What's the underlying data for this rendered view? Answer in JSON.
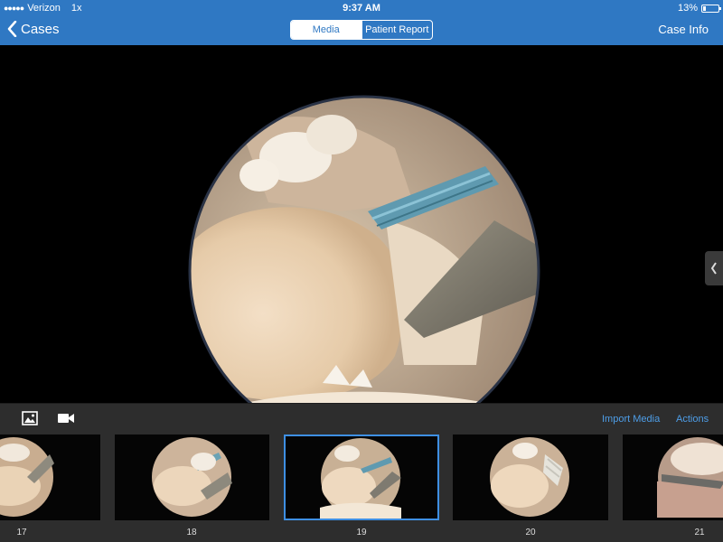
{
  "status_bar": {
    "carrier": "Verizon",
    "zoom": "1x",
    "time": "9:37 AM",
    "battery": "13%"
  },
  "nav": {
    "back_label": "Cases",
    "segments": [
      {
        "label": "Media",
        "active": true
      },
      {
        "label": "Patient Report",
        "active": false
      }
    ],
    "case_info_label": "Case Info"
  },
  "toolbar": {
    "photo_icon": "photo-icon",
    "video_icon": "video-camera-icon",
    "import_label": "Import Media",
    "actions_label": "Actions"
  },
  "thumbnails": [
    {
      "number": "17",
      "selected": false
    },
    {
      "number": "18",
      "selected": false
    },
    {
      "number": "19",
      "selected": true
    },
    {
      "number": "20",
      "selected": false
    },
    {
      "number": "21",
      "selected": false
    }
  ],
  "colors": {
    "nav_blue": "#2f78c3",
    "link_blue": "#4e9ee8",
    "selection_blue": "#3e8fe3",
    "panel_dark": "#2d2d2d"
  }
}
